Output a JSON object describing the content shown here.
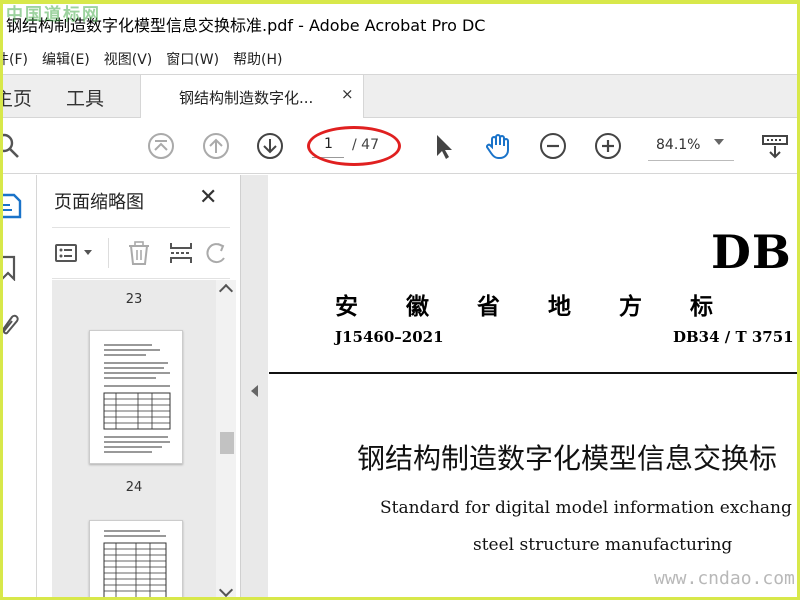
{
  "window": {
    "title": "钢结构制造数字化模型信息交换标准.pdf - Adobe Acrobat Pro DC",
    "watermark_top": "中国道标网",
    "watermark_bottom": "www.cndao.com"
  },
  "menu": [
    "件(F)",
    "编辑(E)",
    "视图(V)",
    "窗口(W)",
    "帮助(H)"
  ],
  "tabs": {
    "home": "主页",
    "tools": "工具",
    "document": "钢结构制造数字化...",
    "close_symbol": "×"
  },
  "toolbar": {
    "current_page": "1",
    "page_count": "/ 47",
    "zoom": "84.1%"
  },
  "panel": {
    "title": "页面缩略图",
    "close_symbol": "✕",
    "page_labels": [
      "23",
      "24"
    ]
  },
  "document": {
    "standard_prefix": "DB",
    "province_line": "安徽省地方标",
    "j_code": "J15460–2021",
    "db_code": "DB34 / T  3751",
    "cn_title": "钢结构制造数字化模型信息交换标",
    "en_title_line1": "Standard for digital model information exchang",
    "en_title_line2": "steel structure manufacturing"
  },
  "colors": {
    "frame": "#d8e84a",
    "annotation_oval": "#e02020",
    "watermark_green": "#4caf50"
  }
}
